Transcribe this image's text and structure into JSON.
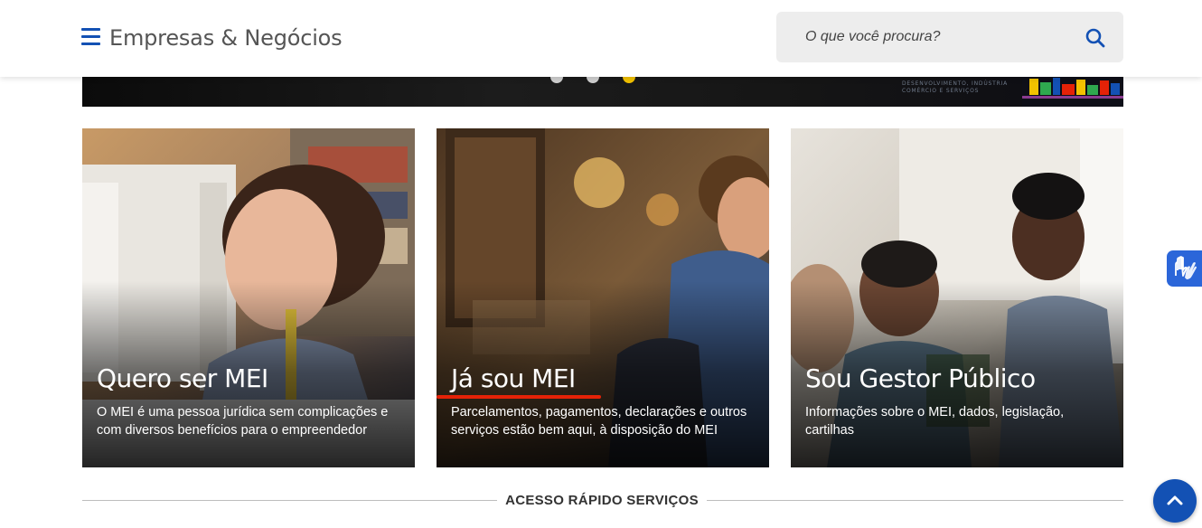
{
  "header": {
    "site_title": "Empresas & Negócios",
    "menu_icon": "hamburger-menu-icon",
    "search": {
      "placeholder": "O que você procura?",
      "value": "",
      "icon": "search-icon"
    }
  },
  "banner": {
    "carousel_dots": 3,
    "active_dot": 3,
    "tag_text": "DESENVOLVIMENTO, INDÚSTRIA COMÉRCIO E SERVIÇOS"
  },
  "cards": [
    {
      "title": "Quero ser MEI",
      "text": "O MEI é uma pessoa jurídica sem complicações e com diversos benefícios para o empreendedor",
      "selected": false
    },
    {
      "title": "Já sou MEI",
      "text": "Parcelamentos, pagamentos, declarações e outros serviços estão bem aqui, à disposição do MEI",
      "selected": true
    },
    {
      "title": "Sou Gestor Público",
      "text": "Informações sobre o MEI, dados, legislação, cartilhas",
      "selected": false
    }
  ],
  "quick_access": {
    "label": "ACESSO RÁPIDO SERVIÇOS"
  },
  "widgets": {
    "accessibility_icon": "sign-language-hands-icon",
    "back_to_top_icon": "chevron-up-icon"
  },
  "colors": {
    "primary": "#1351b4",
    "accent_underline": "#e52207",
    "banner_dot_active": "#f2c200",
    "vlibras": "#2b66d9"
  }
}
